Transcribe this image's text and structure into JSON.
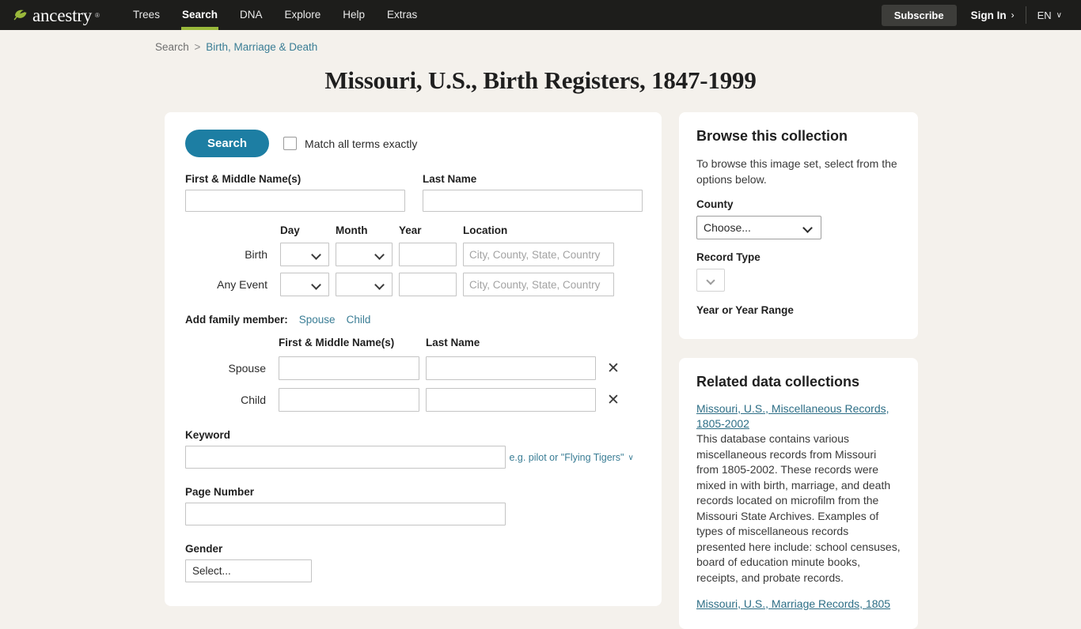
{
  "header": {
    "logo_word": "ancestry",
    "logo_tm": "®",
    "nav": [
      {
        "label": "Trees",
        "active": false
      },
      {
        "label": "Search",
        "active": true
      },
      {
        "label": "DNA",
        "active": false
      },
      {
        "label": "Explore",
        "active": false
      },
      {
        "label": "Help",
        "active": false
      },
      {
        "label": "Extras",
        "active": false
      }
    ],
    "subscribe_label": "Subscribe",
    "signin_label": "Sign In",
    "signin_chevron": "›",
    "lang_label": "EN",
    "lang_caret": "∨",
    "accent_green": "#9ab93b",
    "bar_background": "#1d1d1b"
  },
  "breadcrumb": {
    "root": "Search",
    "separator": ">",
    "current": "Birth, Marriage & Death"
  },
  "page_title": "Missouri, U.S., Birth Registers, 1847-1999",
  "form": {
    "search_button": "Search",
    "match_exactly_label": "Match all terms exactly",
    "first_name_label": "First & Middle Name(s)",
    "first_name_value": "",
    "last_name_label": "Last Name",
    "last_name_value": "",
    "date_headers": {
      "day": "Day",
      "month": "Month",
      "year": "Year",
      "location": "Location"
    },
    "date_rows": [
      {
        "label": "Birth",
        "day": "",
        "month": "",
        "year": "",
        "location_value": "",
        "location_placeholder": "City, County, State, Country"
      },
      {
        "label": "Any Event",
        "day": "",
        "month": "",
        "year": "",
        "location_value": "",
        "location_placeholder": "City, County, State, Country"
      }
    ],
    "add_family_label": "Add family member:",
    "add_family_links": [
      {
        "label": "Spouse"
      },
      {
        "label": "Child"
      }
    ],
    "family_headers": {
      "first": "First & Middle Name(s)",
      "last": "Last Name"
    },
    "family_rows": [
      {
        "label": "Spouse",
        "first_value": "",
        "last_value": "",
        "remove_icon": "✕"
      },
      {
        "label": "Child",
        "first_value": "",
        "last_value": "",
        "remove_icon": "✕"
      }
    ],
    "keyword_label": "Keyword",
    "keyword_value": "",
    "keyword_hint": "e.g. pilot or \"Flying Tigers\"",
    "keyword_hint_caret": "∨",
    "page_number_label": "Page Number",
    "page_number_value": "",
    "gender_label": "Gender",
    "gender_value": "Select..."
  },
  "browse_panel": {
    "title": "Browse this collection",
    "description": "To browse this image set, select from the options below.",
    "county_label": "County",
    "county_value": "Choose...",
    "record_type_label": "Record Type",
    "record_type_value": "",
    "year_range_label": "Year or Year Range"
  },
  "related_panel": {
    "title": "Related data collections",
    "items": [
      {
        "link": "Missouri, U.S., Miscellaneous Records, 1805-2002",
        "description": "This database contains various miscellaneous records from Missouri from 1805-2002. These records were mixed in with birth, marriage, and death records located on microfilm from the Missouri State Archives. Examples of types of miscellaneous records presented here include: school censuses, board of education minute books, receipts, and probate records."
      },
      {
        "link": "Missouri, U.S., Marriage Records, 1805",
        "description": ""
      }
    ]
  },
  "colors": {
    "page_background": "#f4f1ec",
    "card_background": "#ffffff",
    "primary_button": "#1d7ea3",
    "link": "#3a7d95"
  }
}
